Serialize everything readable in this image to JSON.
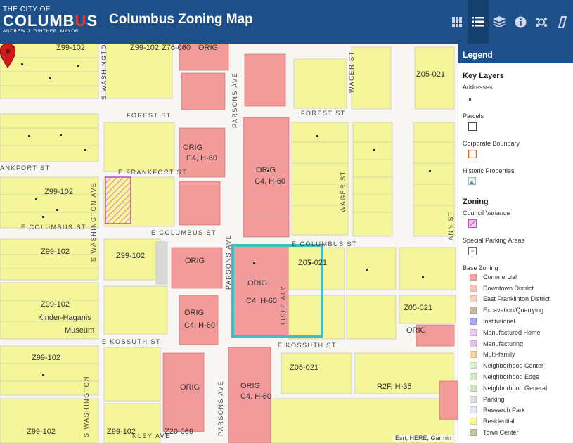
{
  "header": {
    "logo_small": "THE CITY OF",
    "logo_big_1": "COLUMB",
    "logo_big_red": "U",
    "logo_big_2": "S",
    "logo_mayor": "ANDREW J. GINTHER, MAYOR",
    "title": "Columbus Zoning Map",
    "tools": [
      "basemap-gallery-icon",
      "legend-icon",
      "layers-icon",
      "info-icon",
      "share-icon",
      "measure-icon"
    ]
  },
  "legend": {
    "header": "Legend",
    "key_layers_title": "Key Layers",
    "addresses": "Addresses",
    "parcels": "Parcels",
    "corporate_boundary": "Corporate Boundary",
    "historic_properties": "Historic Properties",
    "zoning_title": "Zoning",
    "council_variance": "Council Variance",
    "special_parking": "Special Parking Areas",
    "base_zoning": "Base Zoning",
    "items": [
      {
        "label": "Commercial",
        "color": "#f4a0a0"
      },
      {
        "label": "Downtown District",
        "color": "#f6c7b5"
      },
      {
        "label": "East Franklinton District",
        "color": "#f3d5c0"
      },
      {
        "label": "Excavation/Quarrying",
        "color": "#c8b8a0"
      },
      {
        "label": "Institutional",
        "color": "#a7a7ef"
      },
      {
        "label": "Manufactured Home",
        "color": "#efc8ee"
      },
      {
        "label": "Manufacturing",
        "color": "#e7c6e7"
      },
      {
        "label": "Multi-family",
        "color": "#f4d7a6"
      },
      {
        "label": "Neighborhood Center",
        "color": "#d9efcf"
      },
      {
        "label": "Neighborhood Edge",
        "color": "#d3ecc7"
      },
      {
        "label": "Neighborhood General",
        "color": "#cfe7c3"
      },
      {
        "label": "Parking",
        "color": "#e1e1e1"
      },
      {
        "label": "Research Park",
        "color": "#dde6f4"
      },
      {
        "label": "Residential",
        "color": "#f5f59a"
      },
      {
        "label": "Town Center",
        "color": "#bfc7a4"
      }
    ]
  },
  "map": {
    "streets": {
      "forest_w": "FOREST ST",
      "forest_e": "FOREST ST",
      "frankfort_w": "ANKFORT ST",
      "frankfort_e": "E FRANKFORT ST",
      "columbus_w": "E COLUMBUS ST",
      "columbus_c": "E COLUMBUS ST",
      "columbus_e": "E COLUMBUS ST",
      "kossuth_w": "E KOSSUTH ST",
      "kossuth_e": "E KOSSUTH ST",
      "parsons_n": "PARSONS AVE",
      "parsons_m": "PARSONS AVE",
      "parsons_s": "PARSONS AVE",
      "washington_n": "S WASHINGTON",
      "washington_m": "S WASHINGTON AVE",
      "washington_s": "S WASHINGTON",
      "wager_n": "WAGER ST",
      "wager_s": "WAGER ST",
      "lisle": "LISLE ALY",
      "stanley": "NLEY AVE",
      "pitt": "ANN ST"
    },
    "labels": {
      "orig": "ORIG",
      "z99": "Z99-102",
      "z76": "Z76-060",
      "z05": "Z05-021",
      "z20": "Z20-069",
      "r2f": "R2F, H-35",
      "c4": "C4, H-60",
      "museum": "Museum",
      "haganis": "Kinder-Haganis"
    },
    "attribution": "Esri, HERE, Garmin"
  }
}
